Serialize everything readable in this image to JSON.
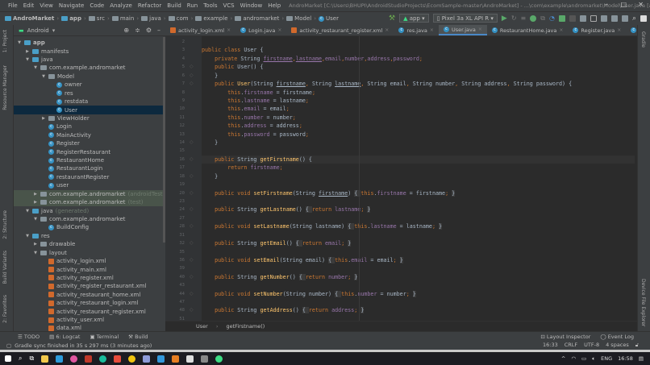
{
  "titlebar": {
    "menu": [
      "File",
      "Edit",
      "View",
      "Navigate",
      "Code",
      "Analyze",
      "Refactor",
      "Build",
      "Run",
      "Tools",
      "VCS",
      "Window",
      "Help"
    ],
    "title": "AndroMarket [C:\\Users\\BHUPI\\AndroidStudioProjects\\EcomSample-master\\AndroMarket] - ...\\com\\example\\andromarket\\Model\\User.java [app]"
  },
  "breadcrumb": [
    "AndroMarket",
    "app",
    "src",
    "main",
    "java",
    "com",
    "example",
    "andromarket",
    "Model",
    "User"
  ],
  "toolbar": {
    "run_config": "app",
    "device": "Pixel 3a XL API R"
  },
  "project_panel": {
    "view": "Android",
    "tree": [
      {
        "label": "app",
        "depth": 0,
        "arrow": "open",
        "icon": "module"
      },
      {
        "label": "manifests",
        "depth": 1,
        "arrow": "closed",
        "icon": "folder"
      },
      {
        "label": "java",
        "depth": 1,
        "arrow": "open",
        "icon": "folder"
      },
      {
        "label": "com.example.andromarket",
        "depth": 2,
        "arrow": "open",
        "icon": "package"
      },
      {
        "label": "Model",
        "depth": 3,
        "arrow": "open",
        "icon": "package"
      },
      {
        "label": "owner",
        "depth": 4,
        "icon": "class"
      },
      {
        "label": "res",
        "depth": 4,
        "icon": "class"
      },
      {
        "label": "restdata",
        "depth": 4,
        "icon": "class"
      },
      {
        "label": "User",
        "depth": 4,
        "icon": "class",
        "selected": true
      },
      {
        "label": "ViewHolder",
        "depth": 3,
        "arrow": "closed",
        "icon": "package"
      },
      {
        "label": "Login",
        "depth": 3,
        "icon": "class"
      },
      {
        "label": "MainActivity",
        "depth": 3,
        "icon": "class"
      },
      {
        "label": "Register",
        "depth": 3,
        "icon": "class"
      },
      {
        "label": "RegisterRestaurant",
        "depth": 3,
        "icon": "class"
      },
      {
        "label": "RestaurantHome",
        "depth": 3,
        "icon": "class"
      },
      {
        "label": "RestaurantLogin",
        "depth": 3,
        "icon": "class"
      },
      {
        "label": "restaurantRegister",
        "depth": 3,
        "icon": "class"
      },
      {
        "label": "user",
        "depth": 3,
        "icon": "class"
      },
      {
        "label": "com.example.andromarket",
        "suffix": "(androidTest)",
        "depth": 2,
        "arrow": "closed",
        "icon": "package",
        "test": true
      },
      {
        "label": "com.example.andromarket",
        "suffix": "(test)",
        "depth": 2,
        "arrow": "closed",
        "icon": "package",
        "test": true
      },
      {
        "label": "java",
        "suffix": "(generated)",
        "depth": 1,
        "arrow": "open",
        "icon": "folder"
      },
      {
        "label": "com.example.andromarket",
        "depth": 2,
        "arrow": "open",
        "icon": "package"
      },
      {
        "label": "BuildConfig",
        "depth": 3,
        "icon": "class"
      },
      {
        "label": "res",
        "depth": 1,
        "arrow": "open",
        "icon": "folder"
      },
      {
        "label": "drawable",
        "depth": 2,
        "arrow": "closed",
        "icon": "package"
      },
      {
        "label": "layout",
        "depth": 2,
        "arrow": "open",
        "icon": "package"
      },
      {
        "label": "activity_login.xml",
        "depth": 3,
        "icon": "xml"
      },
      {
        "label": "activity_main.xml",
        "depth": 3,
        "icon": "xml"
      },
      {
        "label": "activity_register.xml",
        "depth": 3,
        "icon": "xml"
      },
      {
        "label": "activity_register_restaurant.xml",
        "depth": 3,
        "icon": "xml"
      },
      {
        "label": "activity_restaurant_home.xml",
        "depth": 3,
        "icon": "xml"
      },
      {
        "label": "activity_restaurant_login.xml",
        "depth": 3,
        "icon": "xml"
      },
      {
        "label": "activity_restaurant_register.xml",
        "depth": 3,
        "icon": "xml"
      },
      {
        "label": "activity_user.xml",
        "depth": 3,
        "icon": "xml"
      },
      {
        "label": "data.xml",
        "depth": 3,
        "icon": "xml"
      }
    ]
  },
  "left_tools": [
    "1: Project",
    "Resource Manager",
    "2: Structure",
    "Build Variants",
    "2: Favorites"
  ],
  "right_tools": [
    "Gradle",
    "Device File Explorer"
  ],
  "tabs": [
    {
      "label": "activity_login.xml",
      "icon": "xml"
    },
    {
      "label": "Login.java",
      "icon": "class"
    },
    {
      "label": "activity_restaurant_register.xml",
      "icon": "xml"
    },
    {
      "label": "res.java",
      "icon": "class"
    },
    {
      "label": "User.java",
      "icon": "class",
      "active": true
    },
    {
      "label": "RestaurantHome.java",
      "icon": "class"
    },
    {
      "label": "Register.java",
      "icon": "class"
    },
    {
      "label": "RegisterRestaurant.j",
      "icon": "class"
    }
  ],
  "code": [
    {
      "n": "2",
      "t": []
    },
    {
      "n": "3",
      "t": [
        [
          "k",
          "public class "
        ],
        [
          "p",
          "User {"
        ]
      ]
    },
    {
      "n": "4",
      "t": [
        [
          "p",
          "    "
        ],
        [
          "k",
          "private "
        ],
        [
          "p",
          "String "
        ],
        [
          "f ul",
          "firstname"
        ],
        [
          "k",
          ","
        ],
        [
          "f ul",
          "lastname"
        ],
        [
          "k",
          ","
        ],
        [
          "f",
          "email"
        ],
        [
          "k",
          ","
        ],
        [
          "f",
          "number"
        ],
        [
          "k",
          ","
        ],
        [
          "f",
          "address"
        ],
        [
          "k",
          ","
        ],
        [
          "f",
          "password"
        ],
        [
          "k",
          ";"
        ]
      ]
    },
    {
      "n": "5",
      "t": [
        [
          "p",
          "    "
        ],
        [
          "k",
          "public "
        ],
        [
          "p",
          "User() {"
        ]
      ]
    },
    {
      "n": "6",
      "t": [
        [
          "p",
          "    }"
        ]
      ]
    },
    {
      "n": "7",
      "t": [
        [
          "p",
          "    "
        ],
        [
          "k",
          "public "
        ],
        [
          "m",
          "User"
        ],
        [
          "p",
          "(String "
        ],
        [
          "p ul",
          "firstname"
        ],
        [
          "k",
          ", "
        ],
        [
          "p",
          "String "
        ],
        [
          "p ul",
          "lastname"
        ],
        [
          "k",
          ", "
        ],
        [
          "p",
          "String email"
        ],
        [
          "k",
          ", "
        ],
        [
          "p",
          "String number"
        ],
        [
          "k",
          ", "
        ],
        [
          "p",
          "String address"
        ],
        [
          "k",
          ", "
        ],
        [
          "p",
          "String password) {"
        ]
      ]
    },
    {
      "n": "8",
      "t": [
        [
          "p",
          "        "
        ],
        [
          "k",
          "this"
        ],
        [
          "p",
          "."
        ],
        [
          "f",
          "firstname"
        ],
        [
          "p",
          " = firstname"
        ],
        [
          "k",
          ";"
        ]
      ]
    },
    {
      "n": "9",
      "t": [
        [
          "p",
          "        "
        ],
        [
          "k",
          "this"
        ],
        [
          "p",
          "."
        ],
        [
          "f",
          "lastname"
        ],
        [
          "p",
          " = lastname"
        ],
        [
          "k",
          ";"
        ]
      ]
    },
    {
      "n": "10",
      "t": [
        [
          "p",
          "        "
        ],
        [
          "k",
          "this"
        ],
        [
          "p",
          "."
        ],
        [
          "f",
          "email"
        ],
        [
          "p",
          " = email"
        ],
        [
          "k",
          ";"
        ]
      ]
    },
    {
      "n": "11",
      "t": [
        [
          "p",
          "        "
        ],
        [
          "k",
          "this"
        ],
        [
          "p",
          "."
        ],
        [
          "f",
          "number"
        ],
        [
          "p",
          " = number"
        ],
        [
          "k",
          ";"
        ]
      ]
    },
    {
      "n": "12",
      "t": [
        [
          "p",
          "        "
        ],
        [
          "k",
          "this"
        ],
        [
          "p",
          "."
        ],
        [
          "f",
          "address"
        ],
        [
          "p",
          " = address"
        ],
        [
          "k",
          ";"
        ]
      ]
    },
    {
      "n": "13",
      "t": [
        [
          "p",
          "        "
        ],
        [
          "k",
          "this"
        ],
        [
          "p",
          "."
        ],
        [
          "f",
          "password"
        ],
        [
          "p",
          " = password"
        ],
        [
          "k",
          ";"
        ]
      ]
    },
    {
      "n": "14",
      "t": [
        [
          "p",
          "    }"
        ]
      ]
    },
    {
      "n": "15",
      "t": []
    },
    {
      "n": "16",
      "t": [
        [
          "p",
          "    "
        ],
        [
          "k",
          "public "
        ],
        [
          "p",
          "String "
        ],
        [
          "m",
          "getFirstname"
        ],
        [
          "p",
          "() {"
        ]
      ],
      "current": true
    },
    {
      "n": "17",
      "t": [
        [
          "p",
          "        "
        ],
        [
          "k",
          "return "
        ],
        [
          "f",
          "firstname"
        ],
        [
          "k",
          ";"
        ]
      ]
    },
    {
      "n": "18",
      "t": [
        [
          "p",
          "    }"
        ]
      ]
    },
    {
      "n": "19",
      "t": []
    },
    {
      "n": "20",
      "t": [
        [
          "p",
          "    "
        ],
        [
          "k",
          "public void "
        ],
        [
          "m",
          "setFirstname"
        ],
        [
          "p",
          "(String "
        ],
        [
          "p ul",
          "firstname"
        ],
        [
          "p",
          ") "
        ],
        [
          "fold-t",
          "{ "
        ],
        [
          "k",
          "this"
        ],
        [
          "p",
          "."
        ],
        [
          "f",
          "firstname"
        ],
        [
          "p",
          " = firstname"
        ],
        [
          "k",
          "; "
        ],
        [
          "fold-t",
          "}"
        ]
      ]
    },
    {
      "n": "23",
      "t": []
    },
    {
      "n": "24",
      "t": [
        [
          "p",
          "    "
        ],
        [
          "k",
          "public "
        ],
        [
          "p",
          "String "
        ],
        [
          "m",
          "getLastname"
        ],
        [
          "p",
          "() "
        ],
        [
          "fold-t",
          "{ "
        ],
        [
          "k",
          "return "
        ],
        [
          "f",
          "lastname"
        ],
        [
          "k",
          "; "
        ],
        [
          "fold-t",
          "}"
        ]
      ]
    },
    {
      "n": "27",
      "t": []
    },
    {
      "n": "28",
      "t": [
        [
          "p",
          "    "
        ],
        [
          "k",
          "public void "
        ],
        [
          "m",
          "setLastname"
        ],
        [
          "p",
          "(String lastname) "
        ],
        [
          "fold-t",
          "{ "
        ],
        [
          "k",
          "this"
        ],
        [
          "p",
          "."
        ],
        [
          "f",
          "lastname"
        ],
        [
          "p",
          " = lastname"
        ],
        [
          "k",
          "; "
        ],
        [
          "fold-t",
          "}"
        ]
      ]
    },
    {
      "n": "31",
      "t": []
    },
    {
      "n": "32",
      "t": [
        [
          "p",
          "    "
        ],
        [
          "k",
          "public "
        ],
        [
          "p",
          "String "
        ],
        [
          "m",
          "getEmail"
        ],
        [
          "p",
          "() "
        ],
        [
          "fold-t",
          "{ "
        ],
        [
          "k",
          "return "
        ],
        [
          "f",
          "email"
        ],
        [
          "k",
          "; "
        ],
        [
          "fold-t",
          "}"
        ]
      ]
    },
    {
      "n": "35",
      "t": []
    },
    {
      "n": "36",
      "t": [
        [
          "p",
          "    "
        ],
        [
          "k",
          "public void "
        ],
        [
          "m",
          "setEmail"
        ],
        [
          "p",
          "(String email) "
        ],
        [
          "fold-t",
          "{ "
        ],
        [
          "k",
          "this"
        ],
        [
          "p",
          "."
        ],
        [
          "f",
          "email"
        ],
        [
          "p",
          " = email"
        ],
        [
          "k",
          "; "
        ],
        [
          "fold-t",
          "}"
        ]
      ]
    },
    {
      "n": "39",
      "t": []
    },
    {
      "n": "40",
      "t": [
        [
          "p",
          "    "
        ],
        [
          "k",
          "public "
        ],
        [
          "p",
          "String "
        ],
        [
          "m",
          "getNumber"
        ],
        [
          "p",
          "() "
        ],
        [
          "fold-t",
          "{ "
        ],
        [
          "k",
          "return "
        ],
        [
          "f",
          "number"
        ],
        [
          "k",
          "; "
        ],
        [
          "fold-t",
          "}"
        ]
      ]
    },
    {
      "n": "43",
      "t": []
    },
    {
      "n": "44",
      "t": [
        [
          "p",
          "    "
        ],
        [
          "k",
          "public void "
        ],
        [
          "m",
          "setNumber"
        ],
        [
          "p",
          "(String number) "
        ],
        [
          "fold-t",
          "{ "
        ],
        [
          "k",
          "this"
        ],
        [
          "p",
          "."
        ],
        [
          "f",
          "number"
        ],
        [
          "p",
          " = number"
        ],
        [
          "k",
          "; "
        ],
        [
          "fold-t",
          "}"
        ]
      ]
    },
    {
      "n": "47",
      "t": []
    },
    {
      "n": "48",
      "t": [
        [
          "p",
          "    "
        ],
        [
          "k",
          "public "
        ],
        [
          "p",
          "String "
        ],
        [
          "m",
          "getAddress"
        ],
        [
          "p",
          "() "
        ],
        [
          "fold-t",
          "{ "
        ],
        [
          "k",
          "return "
        ],
        [
          "f",
          "address"
        ],
        [
          "k",
          "; "
        ],
        [
          "fold-t",
          "}"
        ]
      ]
    },
    {
      "n": "51",
      "t": []
    }
  ],
  "editor_breadcrumb": [
    "User",
    "getFirstname()"
  ],
  "bottom_tools": [
    "TODO",
    "6: Logcat",
    "Terminal",
    "Build"
  ],
  "bottom_right_tools": [
    "Layout Inspector",
    "Event Log"
  ],
  "status": {
    "message": "Gradle sync finished in 35 s 297 ms (3 minutes ago)",
    "position": "16:33",
    "line_sep": "CRLF",
    "encoding": "UTF-8",
    "indent": "4 spaces"
  },
  "taskbar": {
    "lang": "ENG",
    "time": "16:58"
  },
  "colors": {
    "keyword": "#cc7832",
    "field": "#9876aa",
    "method": "#ffc66d",
    "text": "#a9b7c6",
    "selection": "#0d293e",
    "accent": "#4a88c7"
  }
}
